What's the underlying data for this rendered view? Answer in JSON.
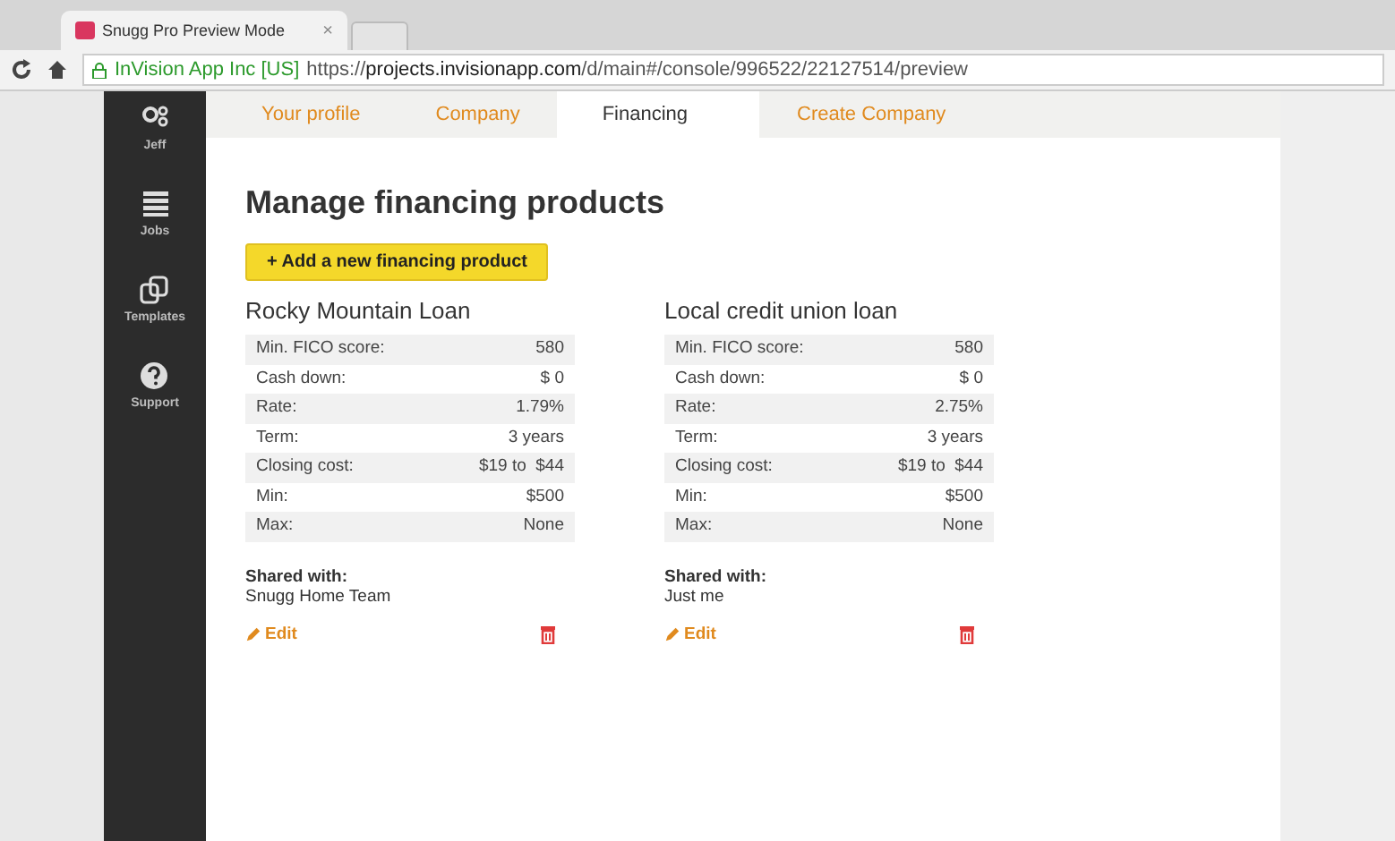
{
  "browser": {
    "tab_title": "Snugg Pro Preview Mode",
    "tab_close": "×",
    "site_identity": "InVision App Inc [US]",
    "url_scheme": "https://",
    "url_host": "projects.invisionapp.com",
    "url_path": "/d/main#/console/996522/22127514/preview"
  },
  "sidebar": {
    "items": [
      {
        "kind": "people",
        "label": "Jeff"
      },
      {
        "kind": "list",
        "label": "Jobs"
      },
      {
        "kind": "templates",
        "label": "Templates"
      },
      {
        "kind": "help",
        "label": "Support"
      }
    ]
  },
  "tabs": [
    {
      "label": "Your profile",
      "selected": false
    },
    {
      "label": "Company",
      "selected": false
    },
    {
      "label": "Financing",
      "selected": true
    },
    {
      "label": "Create Company",
      "selected": false
    }
  ],
  "heading": "Manage financing products",
  "add_button": "+ Add a new financing product",
  "products": [
    {
      "name": "Rocky Mountain Loan",
      "rows": [
        [
          "Min. FICO score:",
          "580"
        ],
        [
          "Cash down:",
          "$ 0"
        ],
        [
          "Rate:",
          "1.79%"
        ],
        [
          "Term:",
          "3 years"
        ],
        [
          "Closing cost:",
          "$19 to  $44"
        ],
        [
          "Min:",
          "$500"
        ],
        [
          "Max:",
          "None"
        ]
      ],
      "shared_label": "Shared with:",
      "shared_value": "Snugg Home Team",
      "edit": "Edit"
    },
    {
      "name": "Local credit union loan",
      "rows": [
        [
          "Min. FICO score:",
          "580"
        ],
        [
          "Cash down:",
          "$ 0"
        ],
        [
          "Rate:",
          "2.75%"
        ],
        [
          "Term:",
          "3 years"
        ],
        [
          "Closing cost:",
          "$19 to  $44"
        ],
        [
          "Min:",
          "$500"
        ],
        [
          "Max:",
          "None"
        ]
      ],
      "shared_label": "Shared with:",
      "shared_value": "Just me",
      "edit": "Edit"
    }
  ]
}
